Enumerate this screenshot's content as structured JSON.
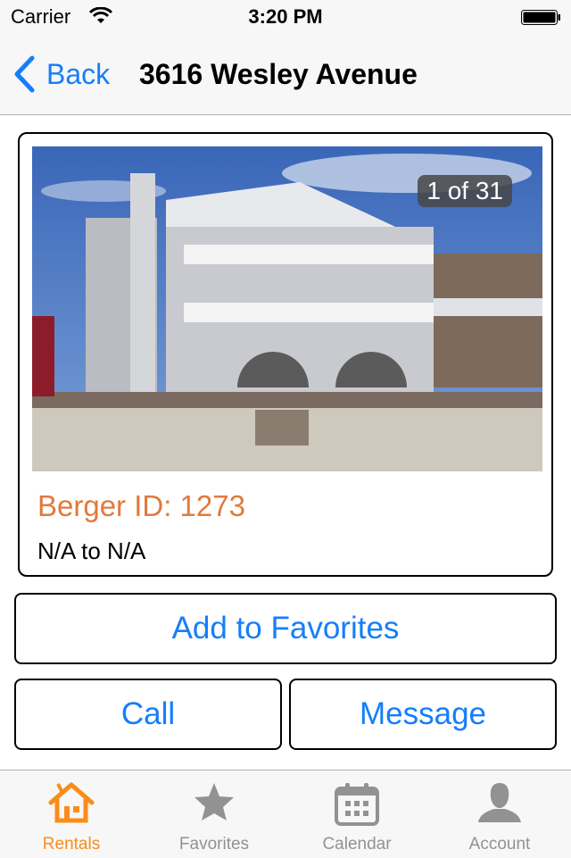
{
  "status_bar": {
    "carrier": "Carrier",
    "time": "3:20 PM"
  },
  "nav": {
    "back_label": "Back",
    "title": "3616 Wesley Avenue"
  },
  "listing": {
    "photo_counter": "1 of 31",
    "berger_id": "Berger ID: 1273",
    "dates": "N/A to N/A"
  },
  "actions": {
    "favorites": "Add to Favorites",
    "call": "Call",
    "message": "Message"
  },
  "tabs": [
    {
      "label": "Rentals",
      "icon": "house-icon",
      "active": true
    },
    {
      "label": "Favorites",
      "icon": "star-icon",
      "active": false
    },
    {
      "label": "Calendar",
      "icon": "calendar-icon",
      "active": false
    },
    {
      "label": "Account",
      "icon": "person-icon",
      "active": false
    }
  ],
  "colors": {
    "accent": "#157efb",
    "active_tab": "#fb8c19",
    "id_text": "#e07a3d",
    "inactive_tab": "#929292"
  }
}
